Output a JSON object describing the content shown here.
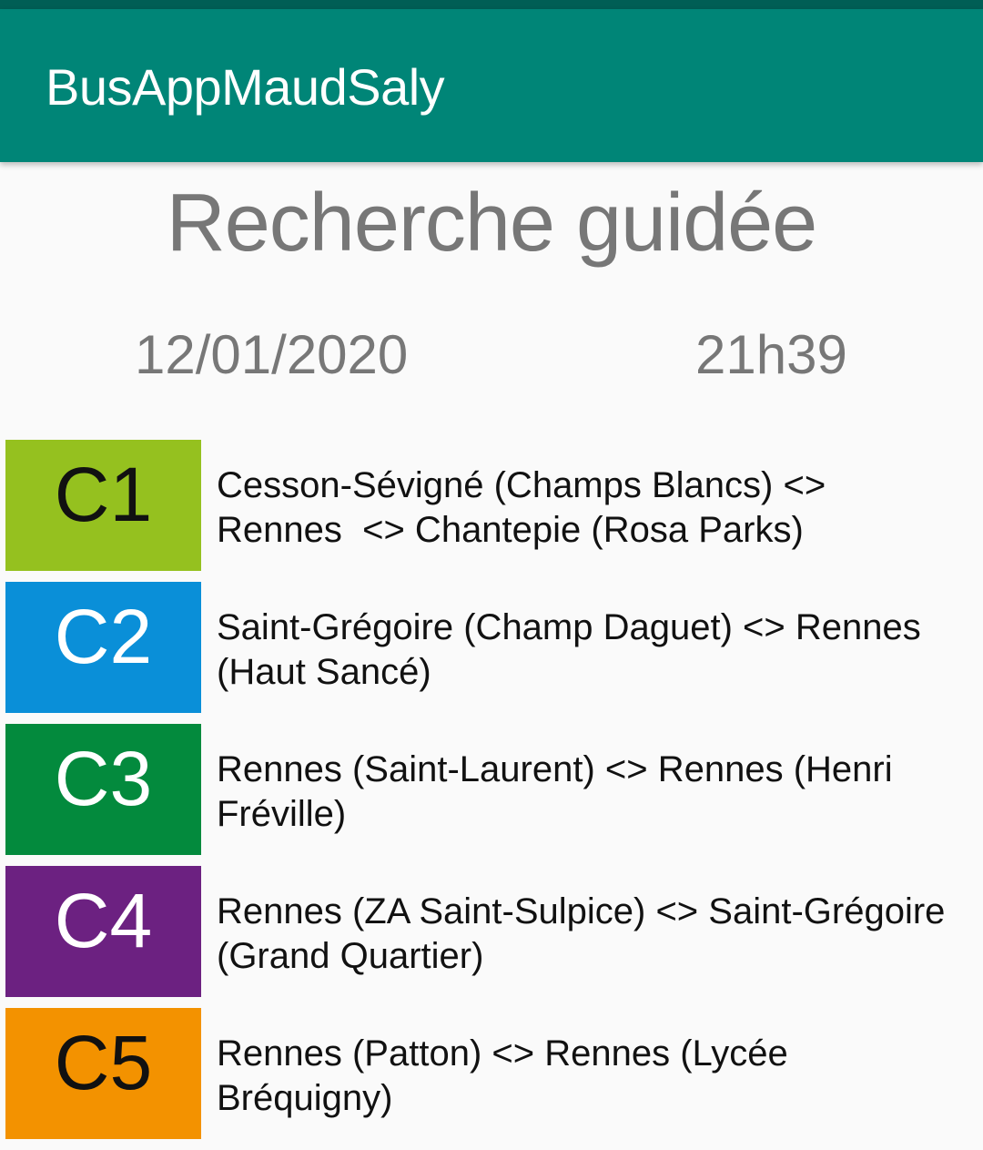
{
  "app": {
    "title": "BusAppMaudSaly",
    "statusbar_color": "#005e55",
    "appbar_color": "#008577"
  },
  "main": {
    "title": "Recherche guidée",
    "date": "12/01/2020",
    "time": "21h39"
  },
  "lines": [
    {
      "code": "C1",
      "color": "#95c11f",
      "text_color": "#111111",
      "description": "Cesson-Sévigné (Champs Blancs) <>\nRennes  <> Chantepie (Rosa Parks)"
    },
    {
      "code": "C2",
      "color": "#0a8fd8",
      "text_color": "#ffffff",
      "description": "Saint-Grégoire (Champ Daguet) <> Rennes\n(Haut Sancé)"
    },
    {
      "code": "C3",
      "color": "#038a3d",
      "text_color": "#ffffff",
      "description": "Rennes (Saint-Laurent) <> Rennes (Henri\nFréville)"
    },
    {
      "code": "C4",
      "color": "#6c2181",
      "text_color": "#ffffff",
      "description": "Rennes (ZA Saint-Sulpice) <> Saint-Grégoire\n(Grand Quartier)"
    },
    {
      "code": "C5",
      "color": "#f39200",
      "text_color": "#111111",
      "description": "Rennes (Patton) <> Rennes (Lycée\nBréquigny)"
    }
  ]
}
